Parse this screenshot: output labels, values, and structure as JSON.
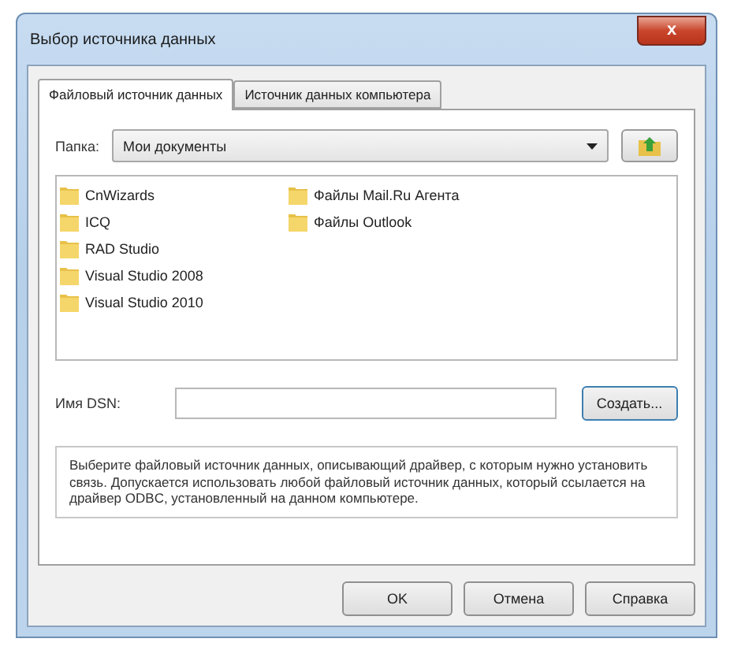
{
  "window": {
    "title": "Выбор источника данных",
    "close": "x"
  },
  "tabs": [
    {
      "label": "Файловый источник данных",
      "selected": true
    },
    {
      "label": "Источник данных компьютера",
      "selected": false
    }
  ],
  "folder": {
    "label": "Папка:",
    "value": "Мои документы"
  },
  "files": [
    {
      "name": "CnWizards"
    },
    {
      "name": "ICQ"
    },
    {
      "name": "RAD Studio"
    },
    {
      "name": "Visual Studio 2008"
    },
    {
      "name": "Visual Studio 2010"
    },
    {
      "name": "Файлы Mail.Ru Агента"
    },
    {
      "name": "Файлы Outlook"
    }
  ],
  "dsn": {
    "label": "Имя DSN:",
    "create": "Создать..."
  },
  "description": "Выберите файловый источник данных, описывающий драйвер, с которым нужно установить связь.   Допускается использовать любой файловый источник данных, который ссылается на драйвер ODBC, установленный на данном компьютере.",
  "buttons": [
    "OK",
    "Отмена",
    "Справка"
  ]
}
